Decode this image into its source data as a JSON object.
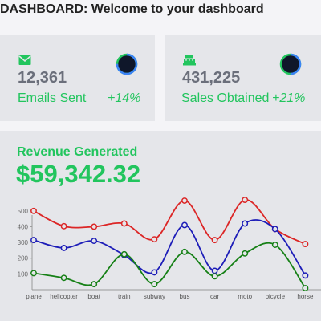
{
  "header": {
    "title": "DASHBOARD: Welcome to your dashboard"
  },
  "stats": [
    {
      "icon": "envelope-icon",
      "value": "12,361",
      "label": "Emails Sent",
      "delta": "+14%",
      "progress": 0.75
    },
    {
      "icon": "cash-register-icon",
      "value": "431,225",
      "label": "Sales Obtained",
      "delta": "+21%",
      "progress": 0.5
    }
  ],
  "revenue": {
    "title": "Revenue Generated",
    "amount": "$59,342.32"
  },
  "colors": {
    "accent": "#22c55e",
    "ring_primary": "#3b82f6",
    "ring_secondary": "#22c55e",
    "card_bg": "#e5e6ea"
  },
  "chart_data": {
    "type": "line",
    "categories": [
      "plane",
      "helicopter",
      "boat",
      "train",
      "subway",
      "bus",
      "car",
      "moto",
      "bicycle",
      "horse"
    ],
    "y_ticks": [
      100,
      200,
      300,
      400,
      500
    ],
    "ylim": [
      0,
      560
    ],
    "grid": false,
    "series": [
      {
        "color": "#dc2626",
        "values": [
          500,
          403,
          400,
          420,
          320,
          565,
          315,
          570,
          385,
          290
        ]
      },
      {
        "color": "#1d1db8",
        "values": [
          315,
          265,
          310,
          220,
          110,
          410,
          120,
          420,
          385,
          90
        ]
      },
      {
        "color": "#168016",
        "values": [
          105,
          75,
          35,
          225,
          35,
          240,
          85,
          230,
          285,
          10
        ]
      }
    ]
  }
}
